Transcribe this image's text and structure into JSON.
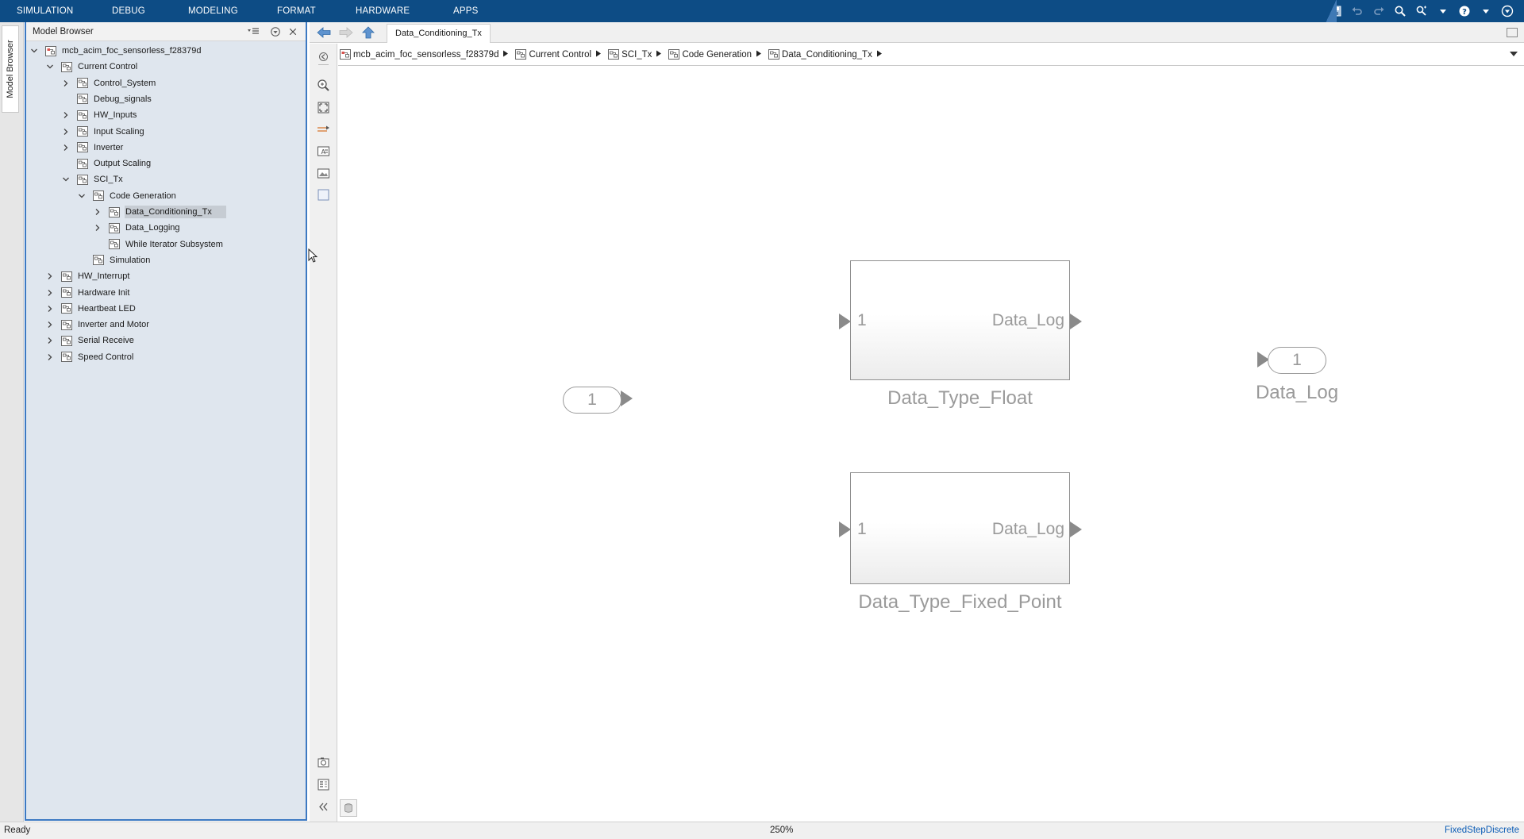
{
  "menu": {
    "items": [
      "SIMULATION",
      "DEBUG",
      "MODELING",
      "FORMAT",
      "HARDWARE",
      "APPS"
    ]
  },
  "quick_access_icons": [
    "save-icon",
    "undo-icon",
    "redo-icon",
    "search-icon",
    "find-icon",
    "chevron-down-icon",
    "help-icon",
    "chevron-down-icon",
    "minimize-ribbon-icon"
  ],
  "side_tab": {
    "label": "Model Browser"
  },
  "model_browser": {
    "title": "Model Browser",
    "tree": [
      {
        "label": "mcb_acim_foc_sensorless_f28379d",
        "level": 0,
        "expander": "expanded",
        "icon": "model-icon"
      },
      {
        "label": "Current Control",
        "level": 1,
        "expander": "expanded",
        "icon": "subsystem-icon"
      },
      {
        "label": "Control_System",
        "level": 2,
        "expander": "collapsed",
        "icon": "subsystem-icon"
      },
      {
        "label": "Debug_signals",
        "level": 2,
        "expander": "none",
        "icon": "subsystem-icon"
      },
      {
        "label": "HW_Inputs",
        "level": 2,
        "expander": "collapsed",
        "icon": "subsystem-icon"
      },
      {
        "label": "Input Scaling",
        "level": 2,
        "expander": "collapsed",
        "icon": "subsystem-icon"
      },
      {
        "label": "Inverter",
        "level": 2,
        "expander": "collapsed",
        "icon": "subsystem-icon"
      },
      {
        "label": "Output Scaling",
        "level": 2,
        "expander": "none",
        "icon": "subsystem-icon"
      },
      {
        "label": "SCI_Tx",
        "level": 2,
        "expander": "expanded",
        "icon": "subsystem-icon"
      },
      {
        "label": "Code Generation",
        "level": 3,
        "expander": "expanded",
        "icon": "subsystem-icon"
      },
      {
        "label": "Data_Conditioning_Tx",
        "level": 4,
        "expander": "collapsed",
        "icon": "subsystem-icon",
        "selected": true
      },
      {
        "label": "Data_Logging",
        "level": 4,
        "expander": "collapsed",
        "icon": "subsystem-icon"
      },
      {
        "label": "While Iterator Subsystem",
        "level": 4,
        "expander": "none",
        "icon": "subsystem-icon"
      },
      {
        "label": "Simulation",
        "level": 3,
        "expander": "none",
        "icon": "subsystem-icon"
      },
      {
        "label": "HW_Interrupt",
        "level": 1,
        "expander": "collapsed",
        "icon": "subsystem-icon"
      },
      {
        "label": "Hardware Init",
        "level": 1,
        "expander": "collapsed",
        "icon": "subsystem-icon"
      },
      {
        "label": "Heartbeat LED",
        "level": 1,
        "expander": "collapsed",
        "icon": "subsystem-icon"
      },
      {
        "label": "Inverter and Motor",
        "level": 1,
        "expander": "collapsed",
        "icon": "subsystem-icon"
      },
      {
        "label": "Serial Receive",
        "level": 1,
        "expander": "collapsed",
        "icon": "subsystem-icon"
      },
      {
        "label": "Speed Control",
        "level": 1,
        "expander": "collapsed",
        "icon": "subsystem-icon"
      }
    ]
  },
  "editor": {
    "active_tab": "Data_Conditioning_Tx",
    "breadcrumb": [
      {
        "label": "mcb_acim_foc_sensorless_f28379d",
        "icon": "model-icon"
      },
      {
        "label": "Current Control",
        "icon": "subsystem-icon"
      },
      {
        "label": "SCI_Tx",
        "icon": "subsystem-icon"
      },
      {
        "label": "Code Generation",
        "icon": "subsystem-icon"
      },
      {
        "label": "Data_Conditioning_Tx",
        "icon": "subsystem-icon"
      }
    ]
  },
  "canvas": {
    "inport": {
      "number": "1"
    },
    "outport": {
      "number": "1",
      "name": "Data_Log"
    },
    "blocks": [
      {
        "name": "Data_Type_Float",
        "in_port": "1",
        "out_port": "Data_Log"
      },
      {
        "name": "Data_Type_Fixed_Point",
        "in_port": "1",
        "out_port": "Data_Log"
      }
    ]
  },
  "status": {
    "text": "Ready",
    "zoom": "250%",
    "solver": "FixedStepDiscrete"
  },
  "colors": {
    "menubar": "#0d4c85",
    "browser_bg": "#dfe6ee",
    "browser_border": "#3c79c2",
    "block_text": "#9a9a9a",
    "link": "#0a5bb5"
  }
}
